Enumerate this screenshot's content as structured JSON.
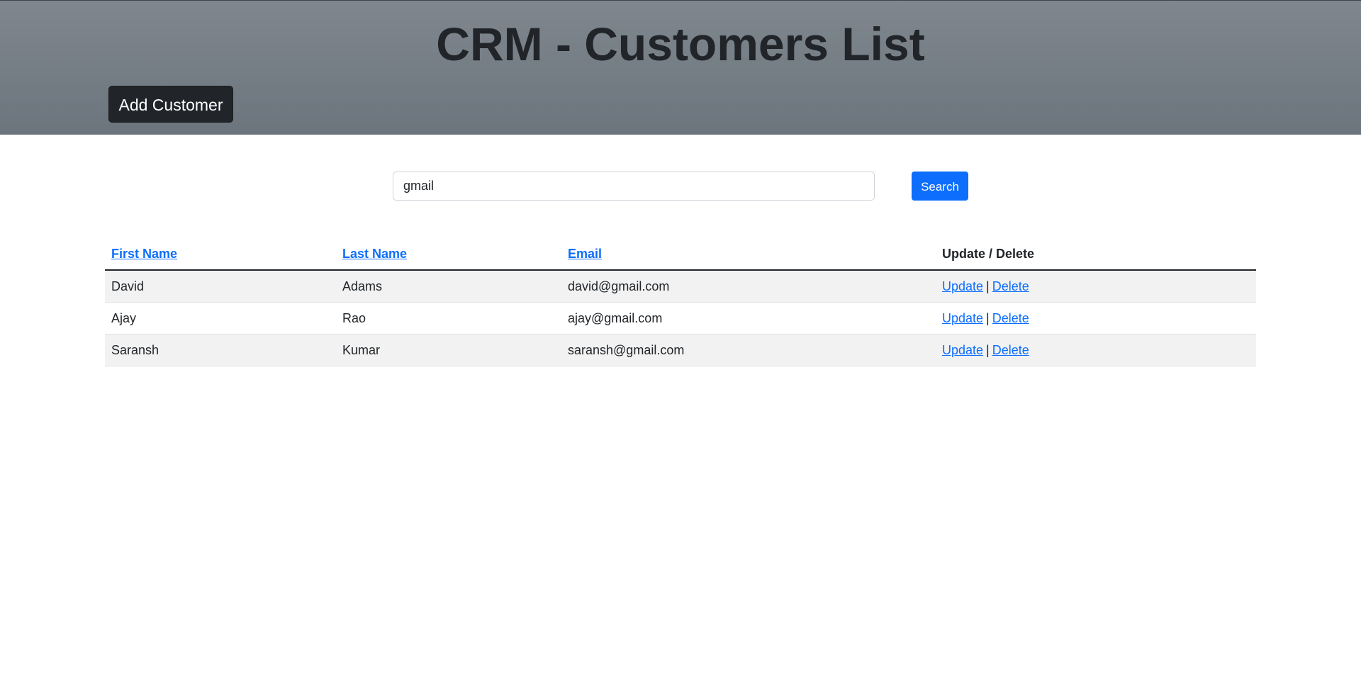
{
  "header": {
    "title": "CRM - Customers List",
    "add_button": "Add Customer"
  },
  "search": {
    "value": "gmail",
    "button": "Search"
  },
  "table": {
    "headers": [
      "First Name",
      "Last Name",
      "Email",
      "Update / Delete"
    ],
    "rows": [
      {
        "first": "David",
        "last": "Adams",
        "email": "david@gmail.com",
        "update": "Update",
        "sep": "|",
        "delete": "Delete"
      },
      {
        "first": "Ajay",
        "last": "Rao",
        "email": "ajay@gmail.com",
        "update": "Update",
        "sep": "|",
        "delete": "Delete"
      },
      {
        "first": "Saransh",
        "last": "Kumar",
        "email": "saransh@gmail.com",
        "update": "Update",
        "sep": "|",
        "delete": "Delete"
      }
    ]
  },
  "colors": {
    "header_bg": "#6c757d",
    "link": "#0d6efd",
    "primary_button": "#0d6efd",
    "dark_button": "#212529",
    "stripe": "#f2f2f2"
  }
}
